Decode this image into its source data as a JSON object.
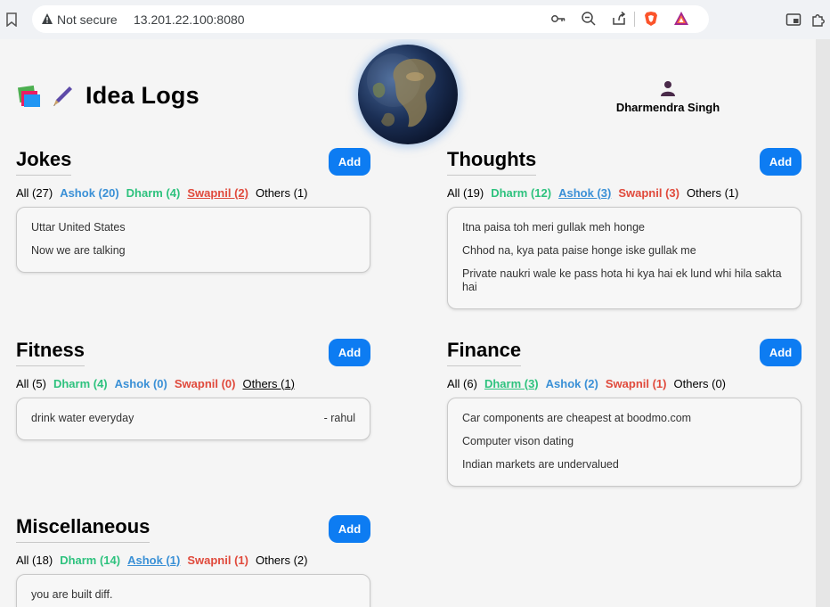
{
  "browser": {
    "security_label": "Not secure",
    "url": "13.201.22.100:8080"
  },
  "header": {
    "title": "Idea Logs",
    "user_name": "Dharmendra Singh"
  },
  "sections": [
    {
      "title": "Jokes",
      "add_label": "Add",
      "filters": [
        "All (27)",
        "Ashok (20)",
        "Dharm (4)",
        "Swapnil (2)",
        "Others (1)"
      ],
      "entries": [
        {
          "text": "Uttar United States"
        },
        {
          "text": "Now we are talking"
        }
      ]
    },
    {
      "title": "Thoughts",
      "add_label": "Add",
      "filters": [
        "All (19)",
        "Dharm (12)",
        "Ashok (3)",
        "Swapnil (3)",
        "Others (1)"
      ],
      "entries": [
        {
          "text": "Itna paisa toh meri gullak meh honge"
        },
        {
          "text": "Chhod na, kya pata paise honge iske gullak me"
        },
        {
          "text": "Private naukri wale ke pass hota hi kya hai ek lund whi hila sakta hai"
        }
      ]
    },
    {
      "title": "Fitness",
      "add_label": "Add",
      "filters": [
        "All (5)",
        "Dharm (4)",
        "Ashok (0)",
        "Swapnil (0)",
        "Others (1)"
      ],
      "entries": [
        {
          "text": "drink water everyday",
          "author": "- rahul"
        }
      ]
    },
    {
      "title": "Finance",
      "add_label": "Add",
      "filters": [
        "All (6)",
        "Dharm (3)",
        "Ashok (2)",
        "Swapnil (1)",
        "Others (0)"
      ],
      "entries": [
        {
          "text": "Car components are cheapest at boodmo.com"
        },
        {
          "text": "Computer vison dating"
        },
        {
          "text": "Indian markets are undervalued"
        }
      ]
    },
    {
      "title": "Miscellaneous",
      "add_label": "Add",
      "filters": [
        "All (18)",
        "Dharm (14)",
        "Ashok (1)",
        "Swapnil (1)",
        "Others (2)"
      ],
      "entries": [
        {
          "text": "you are built diff."
        }
      ]
    }
  ]
}
